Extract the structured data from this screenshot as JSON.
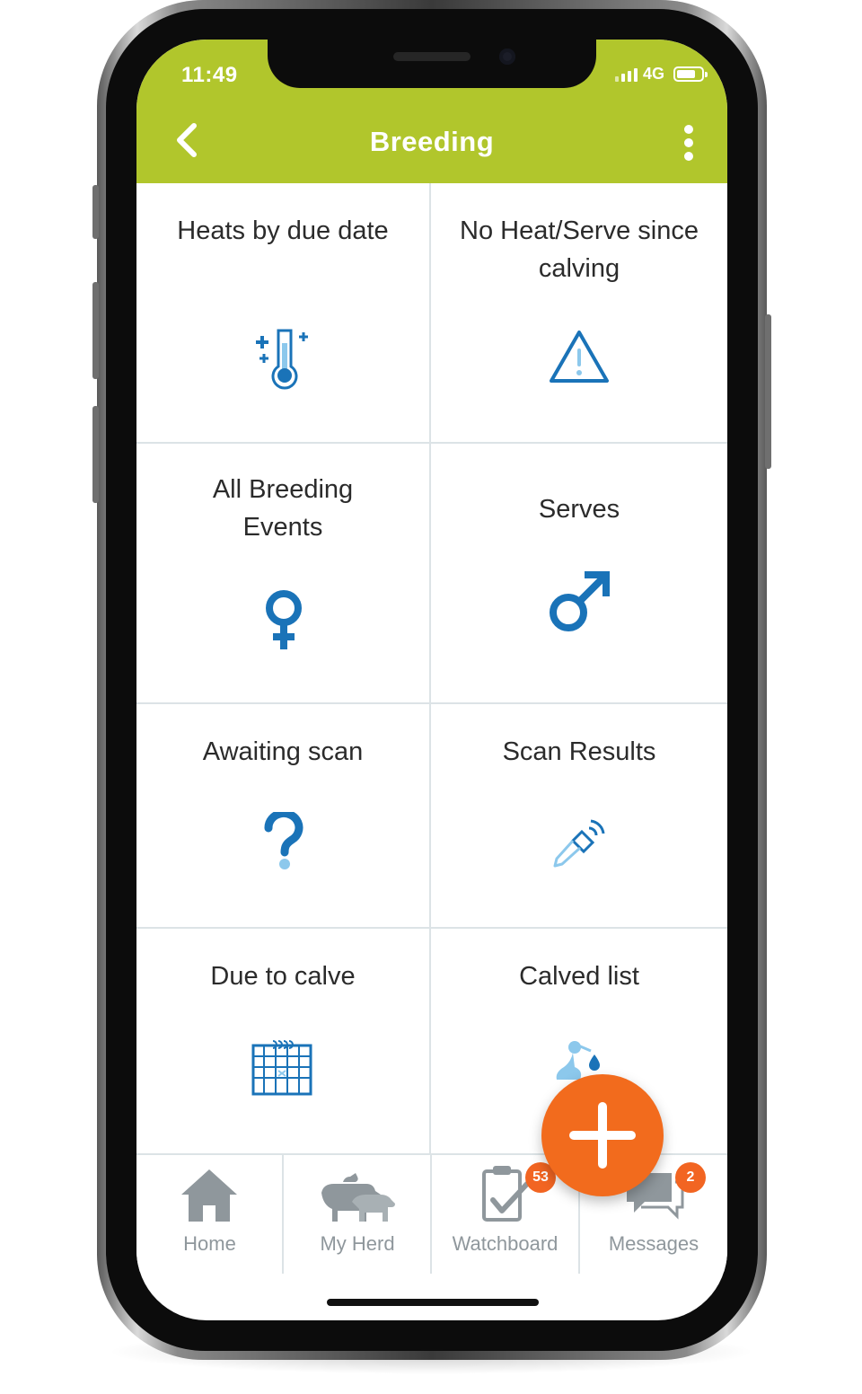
{
  "status_bar": {
    "time": "11:49",
    "network": "4G"
  },
  "header": {
    "title": "Breeding",
    "back_icon": "chevron-left-icon",
    "menu_icon": "more-vertical-icon"
  },
  "tiles": [
    {
      "label": "Heats by due date",
      "icon": "thermometer-icon"
    },
    {
      "label": "No Heat/Serve since calving",
      "icon": "warning-triangle-icon"
    },
    {
      "label": "All Breeding Events",
      "icon": "female-symbol-icon"
    },
    {
      "label": "Serves",
      "icon": "male-symbol-icon"
    },
    {
      "label": "Awaiting scan",
      "icon": "question-mark-icon"
    },
    {
      "label": "Scan Results",
      "icon": "ultrasound-probe-icon"
    },
    {
      "label": "Due to calve",
      "icon": "calendar-icon"
    },
    {
      "label": "Calved list",
      "icon": "stork-icon"
    }
  ],
  "bottom_nav": [
    {
      "label": "Home",
      "icon": "home-icon"
    },
    {
      "label": "My Herd",
      "icon": "herd-animals-icon"
    },
    {
      "label": "Watchboard",
      "icon": "clipboard-check-icon",
      "badge": "53"
    },
    {
      "label": "Messages",
      "icon": "chat-bubbles-icon",
      "badge": "2"
    }
  ],
  "fab": {
    "icon": "plus-icon"
  },
  "colors": {
    "header": "#b1c62c",
    "icon_blue": "#1a73b8",
    "icon_light_blue": "#8cc8ec",
    "accent_orange": "#f26b1d",
    "nav_grey": "#8f979c"
  }
}
